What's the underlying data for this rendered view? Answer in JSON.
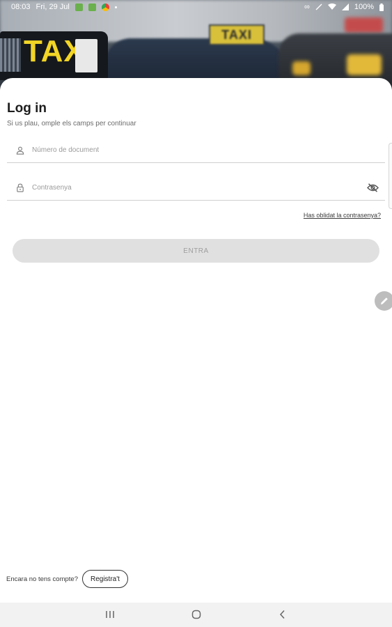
{
  "status_bar": {
    "time": "08:03",
    "date": "Fri, 29 Jul",
    "battery": "100%",
    "icons": [
      "android-icon",
      "android-icon",
      "chrome-icon",
      "dot-icon",
      "voicemail-icon",
      "mute-icon",
      "wifi-icon",
      "signal-icon",
      "battery-icon"
    ]
  },
  "header_image": {
    "description_text": "TAXI",
    "far_sign_text": "TAXI"
  },
  "login": {
    "title": "Log in",
    "subtitle": "Si us plau, omple els camps per continuar",
    "document_placeholder": "Número de document",
    "password_placeholder": "Contrasenya",
    "forgot_password": "Has oblidat la contrasenya?",
    "submit_label": "ENTRA"
  },
  "footer": {
    "no_account_text": "Encara no tens compte?",
    "register_label": "Registra't"
  },
  "colors": {
    "button_disabled_bg": "#e0e0e0",
    "button_disabled_text": "#9e9e9e",
    "taxi_yellow": "#f2d526"
  }
}
